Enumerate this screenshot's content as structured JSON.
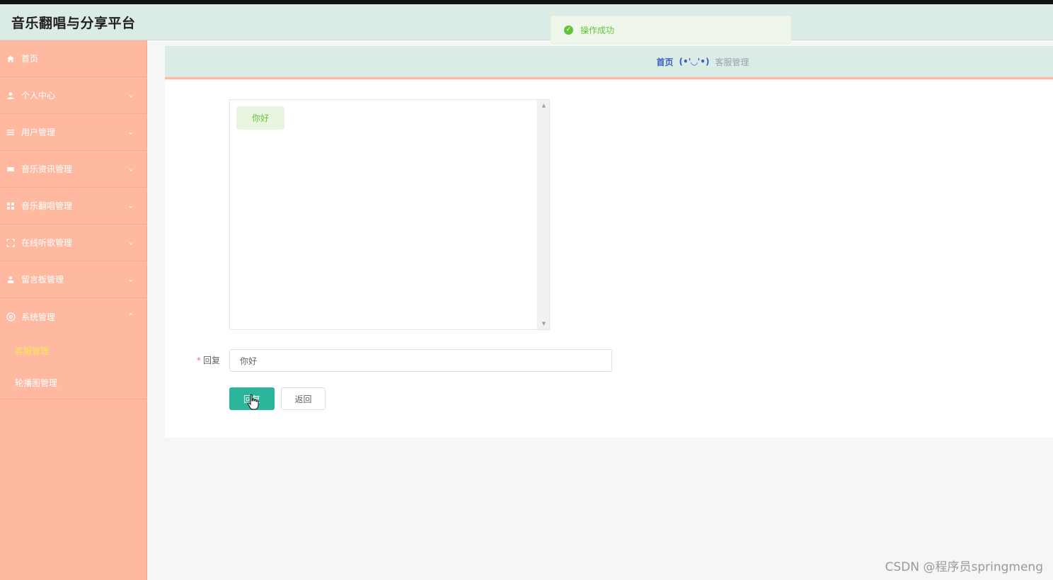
{
  "app": {
    "title": "音乐翻唱与分享平台"
  },
  "toast": {
    "message": "操作成功",
    "icon": "check-circle-icon"
  },
  "sidebar": {
    "items": [
      {
        "label": "首页",
        "icon": "home-icon"
      },
      {
        "label": "个人中心",
        "icon": "user-icon"
      },
      {
        "label": "用户管理",
        "icon": "list-icon"
      },
      {
        "label": "音乐资讯管理",
        "icon": "ticket-icon"
      },
      {
        "label": "音乐翻唱管理",
        "icon": "grid-icon"
      },
      {
        "label": "在线听歌管理",
        "icon": "fullscreen-icon"
      },
      {
        "label": "留言板管理",
        "icon": "person-icon"
      },
      {
        "label": "系统管理",
        "icon": "settings-icon"
      }
    ],
    "submenu": [
      {
        "label": "客服管理",
        "active": true
      },
      {
        "label": "轮播图管理",
        "active": false
      }
    ]
  },
  "breadcrumb": {
    "home": "首页",
    "separator": "(•'◡'•)",
    "current": "客服管理"
  },
  "chat": {
    "messages": [
      "你好"
    ]
  },
  "reply_form": {
    "label": "回复",
    "required_mark": "*",
    "value": "你好",
    "submit_label": "回复",
    "back_label": "返回"
  },
  "watermark": "CSDN @程序员springmeng",
  "colors": {
    "sidebar": "#ffb9a0",
    "header": "#dbece6",
    "primary": "#2bb59b",
    "active_submenu": "#f7e95a"
  }
}
